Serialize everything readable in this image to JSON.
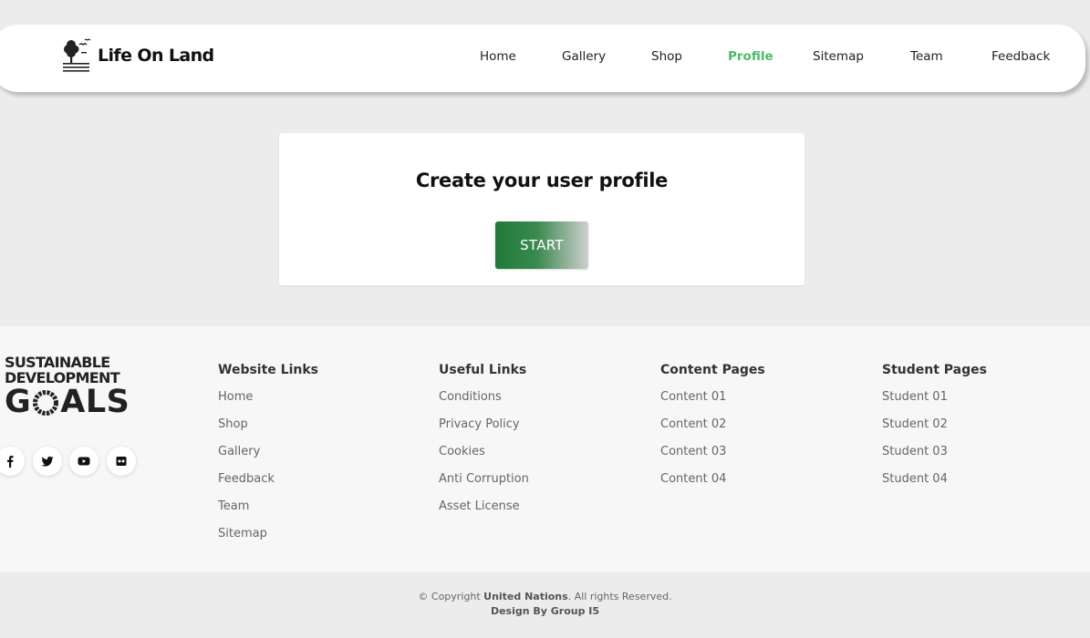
{
  "header": {
    "brand_name": "Life On Land",
    "nav": [
      {
        "label": "Home",
        "active": false
      },
      {
        "label": "Gallery",
        "active": false
      },
      {
        "label": "Shop",
        "active": false
      },
      {
        "label": "Profile",
        "active": true
      },
      {
        "label": "Sitemap",
        "active": false
      },
      {
        "label": "Team",
        "active": false
      },
      {
        "label": "Feedback",
        "active": false
      }
    ]
  },
  "profile_card": {
    "title": "Create your user profile",
    "button_label": "START"
  },
  "footer": {
    "logo": {
      "line1": "SUSTAINABLE",
      "line2": "DEVELOPMENT",
      "line3_start": "G",
      "line3_end": "ALS"
    },
    "socials": [
      {
        "icon": "facebook-icon"
      },
      {
        "icon": "twitter-icon"
      },
      {
        "icon": "youtube-icon"
      },
      {
        "icon": "flickr-icon"
      }
    ],
    "columns": [
      {
        "heading": "Website Links",
        "links": [
          "Home",
          "Shop",
          "Gallery",
          "Feedback",
          "Team",
          "Sitemap"
        ]
      },
      {
        "heading": "Useful Links",
        "links": [
          "Conditions",
          "Privacy Policy",
          "Cookies",
          "Anti Corruption",
          "Asset License"
        ]
      },
      {
        "heading": "Content Pages",
        "links": [
          "Content 01",
          "Content 02",
          "Content 03",
          "Content 04"
        ]
      },
      {
        "heading": "Student Pages",
        "links": [
          "Student 01",
          "Student 02",
          "Student 03",
          "Student 04"
        ]
      }
    ]
  },
  "copyright": {
    "prefix": "© Copyright ",
    "org": "United Nations",
    "suffix": ". All rights Reserved.",
    "design": "Design By Group I5"
  },
  "colors": {
    "page_bg": "#ececec",
    "nav_active": "#4cbb6a",
    "button_gradient_start": "#1f7a39",
    "button_gradient_end": "#cfcfcf",
    "footer_bg": "#f7f7f7"
  }
}
